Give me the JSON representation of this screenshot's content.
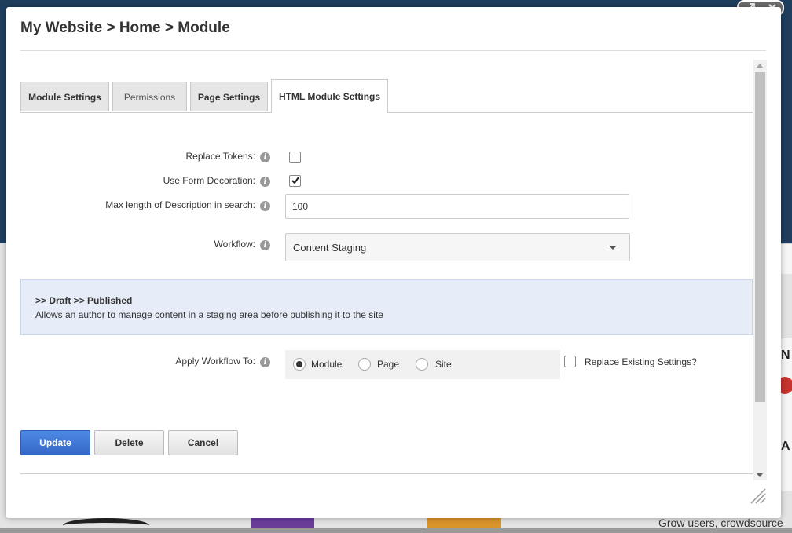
{
  "breadcrumb": "My Website > Home > Module",
  "tabs": [
    {
      "label": "Module Settings"
    },
    {
      "label": "Permissions"
    },
    {
      "label": "Page Settings"
    },
    {
      "label": "HTML Module Settings"
    }
  ],
  "form": {
    "replace_tokens": {
      "label": "Replace Tokens:",
      "checked": false
    },
    "use_form_decoration": {
      "label": "Use Form Decoration:",
      "checked": true
    },
    "max_length": {
      "label": "Max length of Description in search:",
      "value": "100"
    },
    "workflow": {
      "label": "Workflow:",
      "selected": "Content Staging"
    },
    "workflow_info": {
      "steps": ">> Draft >> Published",
      "description": "Allows an author to manage content in a staging area before publishing it to the site"
    },
    "apply_workflow": {
      "label": "Apply Workflow To:",
      "options": [
        "Module",
        "Page",
        "Site"
      ],
      "selected": "Module"
    },
    "replace_existing": {
      "label": "Replace Existing Settings?",
      "checked": false
    }
  },
  "buttons": {
    "update": "Update",
    "delete": "Delete",
    "cancel": "Cancel"
  },
  "background": {
    "grow_text": "Grow users, crowdsource",
    "letter_n": "N",
    "letter_a": "A"
  },
  "colors": {
    "primary_button": "#3c78d8",
    "workflow_box": "#e6edf8",
    "page_header": "#1f3e5e"
  },
  "icons": {
    "info": "info-icon",
    "expand": "expand-icon",
    "close": "close-icon",
    "checkmark": "checkmark-icon",
    "dropdown": "chevron-down-icon",
    "resize": "resize-grip-icon"
  }
}
